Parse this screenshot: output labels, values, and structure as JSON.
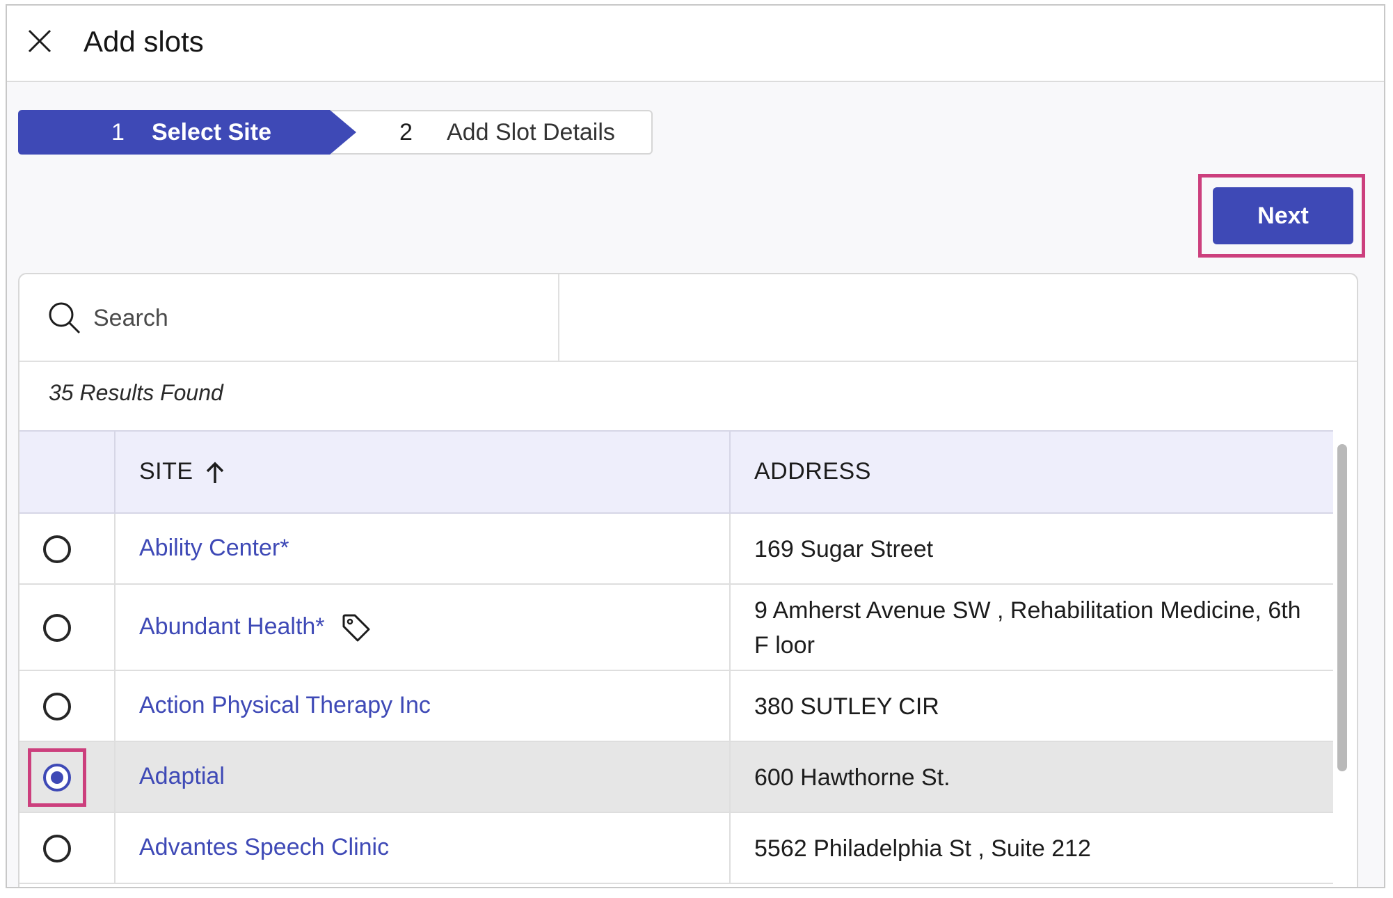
{
  "header": {
    "title": "Add slots"
  },
  "stepper": {
    "steps": [
      {
        "number": "1",
        "label": "Select Site"
      },
      {
        "number": "2",
        "label": "Add Slot Details"
      }
    ]
  },
  "actions": {
    "next_label": "Next"
  },
  "search": {
    "placeholder": "Search",
    "value": ""
  },
  "results": {
    "count_text": "35 Results Found"
  },
  "table": {
    "columns": {
      "site": "SITE",
      "address": "ADDRESS"
    },
    "rows": [
      {
        "site": "Ability Center*",
        "address": "169 Sugar Street",
        "selected": false,
        "tagged": false
      },
      {
        "site": "Abundant Health*",
        "address": "9 Amherst Avenue SW , Rehabilitation Medicine, 6th F loor",
        "selected": false,
        "tagged": true
      },
      {
        "site": "Action Physical Therapy Inc",
        "address": "380 SUTLEY CIR",
        "selected": false,
        "tagged": false
      },
      {
        "site": "Adaptial",
        "address": "600 Hawthorne St.",
        "selected": true,
        "tagged": false
      },
      {
        "site": "Advantes Speech Clinic",
        "address": "5562 Philadelphia St , Suite 212",
        "selected": false,
        "tagged": false
      }
    ]
  },
  "colors": {
    "accent": "#3e49b6",
    "highlight": "#cc3f7d",
    "header_bg": "#eeeefb",
    "selected_row": "#e6e6e6"
  },
  "icons": {
    "close": "close-icon",
    "search": "search-icon",
    "sort": "arrow-up-icon",
    "tag": "tag-icon"
  }
}
